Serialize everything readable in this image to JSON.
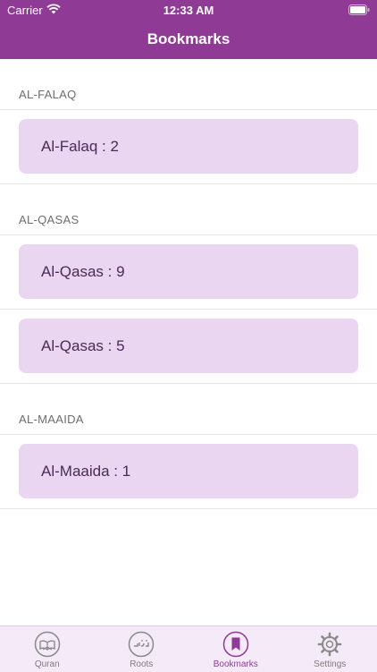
{
  "status_bar": {
    "carrier": "Carrier",
    "time": "12:33 AM"
  },
  "nav": {
    "title": "Bookmarks"
  },
  "sections": [
    {
      "header": "AL-FALAQ",
      "items": [
        "Al-Falaq : 2"
      ]
    },
    {
      "header": "AL-QASAS",
      "items": [
        "Al-Qasas : 9",
        "Al-Qasas : 5"
      ]
    },
    {
      "header": "AL-MAAIDA",
      "items": [
        "Al-Maaida : 1"
      ]
    }
  ],
  "tabs": [
    {
      "label": "Quran",
      "icon": "quran-book-icon"
    },
    {
      "label": "Roots",
      "icon": "arabic-roots-icon"
    },
    {
      "label": "Bookmarks",
      "icon": "bookmark-icon",
      "active": true
    },
    {
      "label": "Settings",
      "icon": "gear-icon"
    }
  ],
  "colors": {
    "accent": "#8f3b96",
    "card_bg": "#ead6f1",
    "tab_bar_bg": "#f5eaf8"
  }
}
